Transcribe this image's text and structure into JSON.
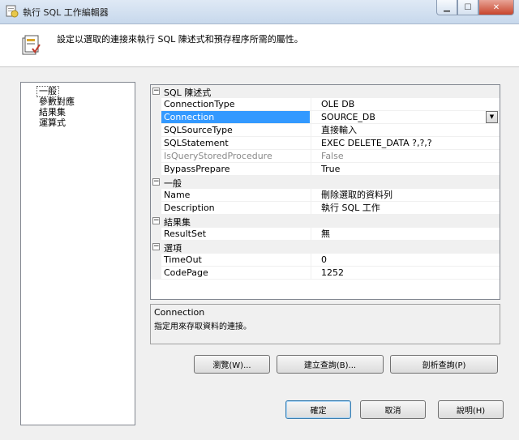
{
  "window": {
    "title": "執行 SQL 工作編輯器"
  },
  "header": {
    "description": "設定以選取的連接來執行 SQL 陳述式和預存程序所需的屬性。"
  },
  "nav": {
    "items": [
      "一般",
      "參數對應",
      "結果集",
      "運算式"
    ]
  },
  "grid": {
    "cat_sql": "SQL 陳述式",
    "cat_general": "一般",
    "cat_resultset": "結果集",
    "cat_options": "選項",
    "rows": {
      "connection_type": {
        "name": "ConnectionType",
        "value": "OLE DB"
      },
      "connection": {
        "name": "Connection",
        "value": "SOURCE_DB"
      },
      "sql_source_type": {
        "name": "SQLSourceType",
        "value": "直接輸入"
      },
      "sql_statement": {
        "name": "SQLStatement",
        "value": "EXEC DELETE_DATA ?,?,?"
      },
      "is_query_stored_procedure": {
        "name": "IsQueryStoredProcedure",
        "value": "False"
      },
      "bypass_prepare": {
        "name": "BypassPrepare",
        "value": "True"
      },
      "name": {
        "name": "Name",
        "value": "刪除選取的資料列"
      },
      "description": {
        "name": "Description",
        "value": "執行 SQL 工作"
      },
      "result_set": {
        "name": "ResultSet",
        "value": "無"
      },
      "timeout": {
        "name": "TimeOut",
        "value": "0"
      },
      "code_page": {
        "name": "CodePage",
        "value": "1252"
      }
    }
  },
  "desc_panel": {
    "title": "Connection",
    "text": "指定用來存取資料的連接。"
  },
  "buttons": {
    "browse": "瀏覽(W)...",
    "build_query": "建立查詢(B)...",
    "parse_query": "剖析查詢(P)",
    "ok": "確定",
    "cancel": "取消",
    "help": "說明(H)"
  }
}
